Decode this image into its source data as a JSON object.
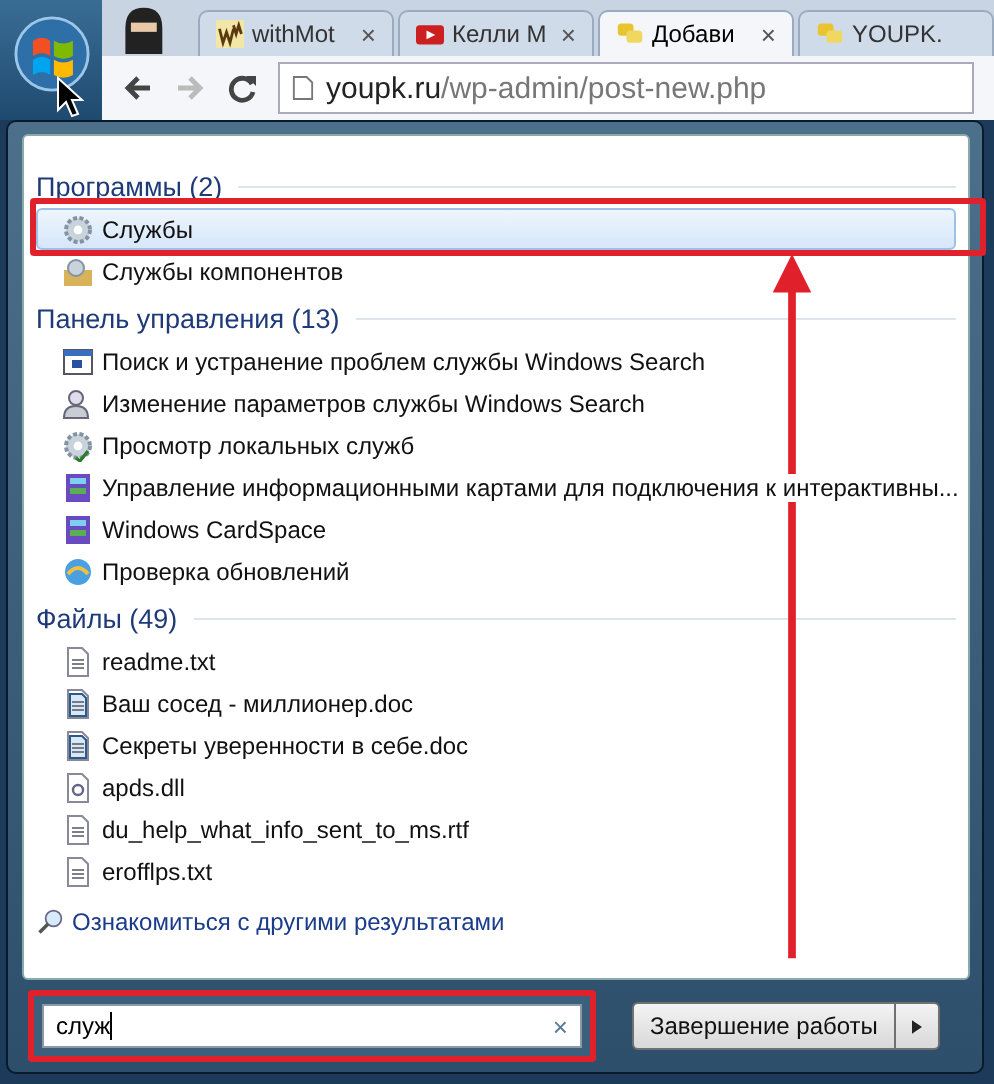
{
  "browser": {
    "tabs": [
      {
        "label": "withMot",
        "kind": "wm",
        "selected": false,
        "close": "×"
      },
      {
        "label": "Келли М",
        "kind": "video",
        "selected": false,
        "close": "×"
      },
      {
        "label": "Добави",
        "kind": "site",
        "selected": true,
        "close": "×"
      },
      {
        "label": "YOUPK.",
        "kind": "site",
        "selected": false
      }
    ],
    "address": {
      "domain": "youpk.ru",
      "path": "/wp-admin/post-new.php"
    }
  },
  "start_menu": {
    "groups": [
      {
        "title": "Программы (2)",
        "items": [
          {
            "label": "Службы",
            "kind": "gear",
            "selected": true
          },
          {
            "label": "Службы компонентов",
            "kind": "gearbox",
            "selected": false
          }
        ]
      },
      {
        "title": "Панель управления (13)",
        "items": [
          {
            "label": "Поиск и устранение проблем службы Windows Search",
            "kind": "troubleshoot",
            "selected": false
          },
          {
            "label": "Изменение параметров службы Windows Search",
            "kind": "user",
            "selected": false
          },
          {
            "label": "Просмотр локальных служб",
            "kind": "gearcheck",
            "selected": false
          },
          {
            "label": "Управление информационными картами для подключения к интерактивны...",
            "kind": "card",
            "selected": false
          },
          {
            "label": "Windows CardSpace",
            "kind": "card",
            "selected": false
          },
          {
            "label": "Проверка обновлений",
            "kind": "update",
            "selected": false
          }
        ]
      },
      {
        "title": "Файлы (49)",
        "items": [
          {
            "label": "readme.txt",
            "kind": "txt",
            "selected": false
          },
          {
            "label": "Ваш сосед - миллионер.doc",
            "kind": "doc",
            "selected": false
          },
          {
            "label": "Секреты уверенности в себе.doc",
            "kind": "doc",
            "selected": false
          },
          {
            "label": "apds.dll",
            "kind": "dll",
            "selected": false
          },
          {
            "label": "du_help_what_info_sent_to_ms.rtf",
            "kind": "rtf",
            "selected": false
          },
          {
            "label": "erofflps.txt",
            "kind": "txt",
            "selected": false
          }
        ]
      }
    ],
    "more_results": "Ознакомиться с другими результатами",
    "search": {
      "value": "служ",
      "clear": "×"
    },
    "shutdown": {
      "label": "Завершение работы"
    }
  }
}
